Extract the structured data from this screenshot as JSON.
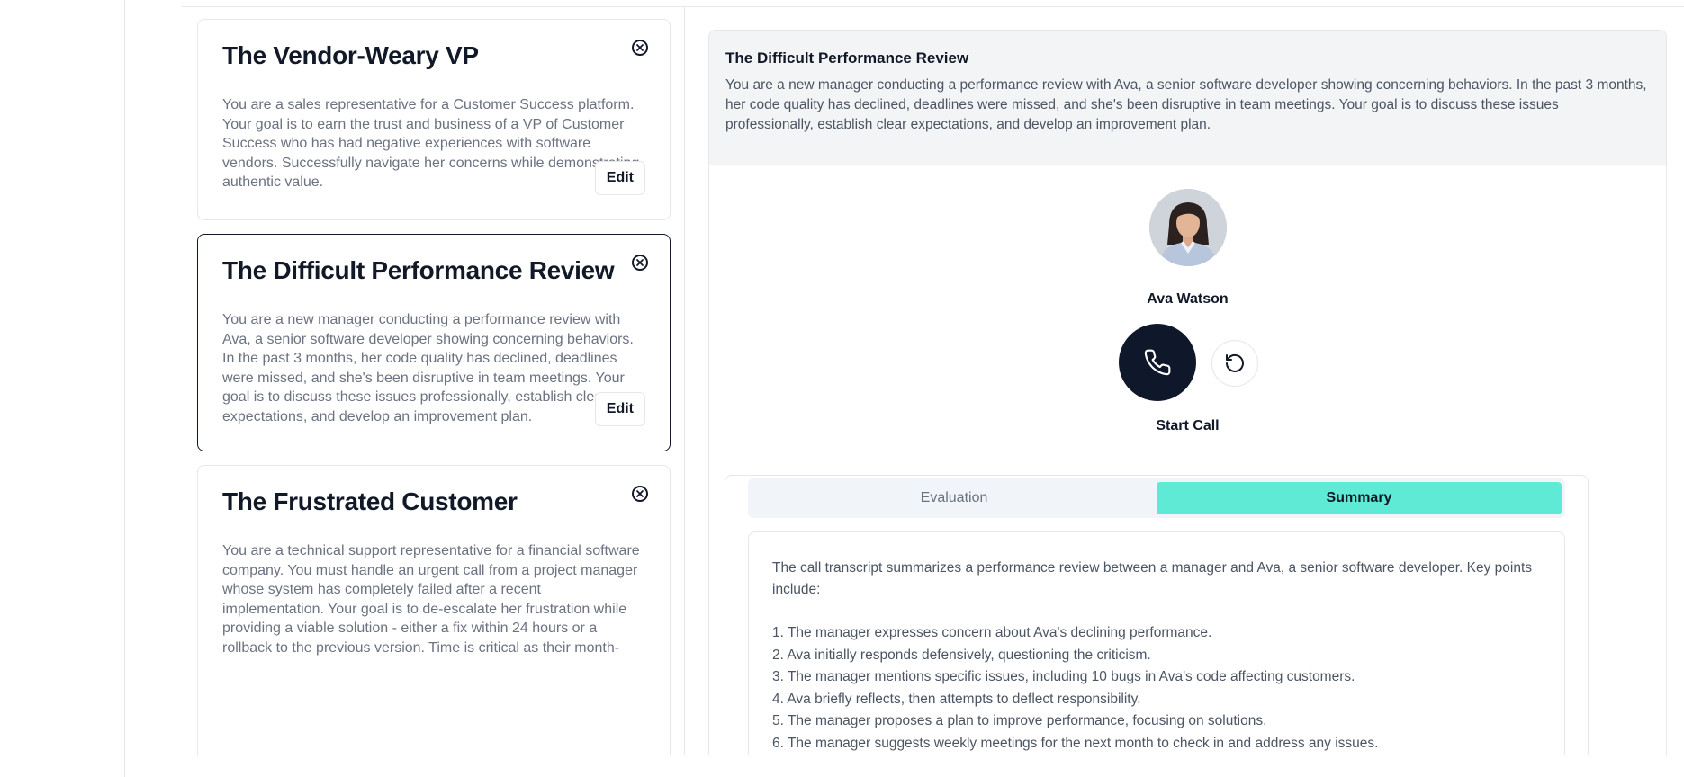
{
  "scenarios": [
    {
      "title": "The Vendor-Weary VP",
      "description": "You are a sales representative for a Customer Success platform. Your goal is to earn the trust and business of a VP of Customer Success who has had negative experiences with software vendors. Successfully navigate her concerns while demonstrating authentic value.",
      "edit_label": "Edit"
    },
    {
      "title": "The Difficult Performance Review",
      "description": "You are a new manager conducting a performance review with Ava, a senior software developer showing concerning behaviors. In the past 3 months, her code quality has declined, deadlines were missed, and she's been disruptive in team meetings. Your goal is to discuss these issues professionally, establish clear expectations, and develop an improvement plan.",
      "edit_label": "Edit"
    },
    {
      "title": "The Frustrated Customer",
      "description": "You are a technical support representative for a financial software company. You must handle an urgent call from a project manager whose system has completely failed after a recent implementation. Your goal is to de-escalate her frustration while providing a viable solution - either a fix within 24 hours or a rollback to the previous version. Time is critical as their month-",
      "edit_label": "Edit"
    }
  ],
  "detail": {
    "title": "The Difficult Performance Review",
    "description": "You are a new manager conducting a performance review with Ava, a senior software developer showing concerning behaviors. In the past 3 months, her code quality has declined, deadlines were missed, and she's been disruptive in team meetings. Your goal is to discuss these issues professionally, establish clear expectations, and develop an improvement plan.",
    "persona_name": "Ava Watson",
    "call_label": "Start Call"
  },
  "tabs": {
    "evaluation": "Evaluation",
    "summary": "Summary"
  },
  "summary": {
    "intro": "The call transcript summarizes a performance review between a manager and Ava, a senior software developer. Key points include:",
    "points": [
      "1. The manager expresses concern about Ava's declining performance.",
      "2. Ava initially responds defensively, questioning the criticism.",
      "3. The manager mentions specific issues, including 10 bugs in Ava's code affecting customers.",
      "4. Ava briefly reflects, then attempts to deflect responsibility.",
      "5. The manager proposes a plan to improve performance, focusing on solutions.",
      "6. The manager suggests weekly meetings for the next month to check in and address any issues."
    ]
  },
  "icons": {
    "close": "close-circle-icon",
    "phone": "phone-icon",
    "reset": "rotate-ccw-icon"
  },
  "colors": {
    "call_button": "#0f172a",
    "active_tab": "#5eead4",
    "header_bg": "#f3f4f6",
    "muted_text": "#6b7280"
  }
}
